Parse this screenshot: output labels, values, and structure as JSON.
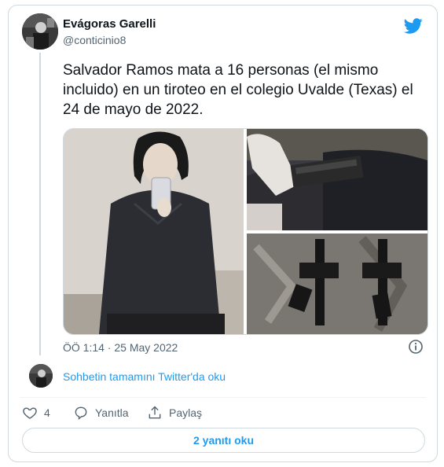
{
  "author": {
    "display_name": "Evágoras Garelli",
    "handle": "@conticinio8"
  },
  "tweet": {
    "text": "Salvador Ramos mata a 16 personas (el mismo incluido) en un tiroteo en el colegio Uvalde (Texas) el 24 de mayo de 2022.",
    "timestamp": "ÖÖ 1:14 · 25 May 2022"
  },
  "conversation_link": "Sohbetin tamamını Twitter'da oku",
  "actions": {
    "like_count": "4",
    "reply_label": "Yanıtla",
    "share_label": "Paylaş"
  },
  "read_replies_label": "2 yanıtı oku",
  "colors": {
    "twitter_blue": "#1d9bf0",
    "text_primary": "#0f1419",
    "text_secondary": "#536471",
    "border": "#cfd9de"
  },
  "icons": [
    "twitter-bird-icon",
    "info-icon",
    "heart-icon",
    "reply-icon",
    "share-icon"
  ]
}
